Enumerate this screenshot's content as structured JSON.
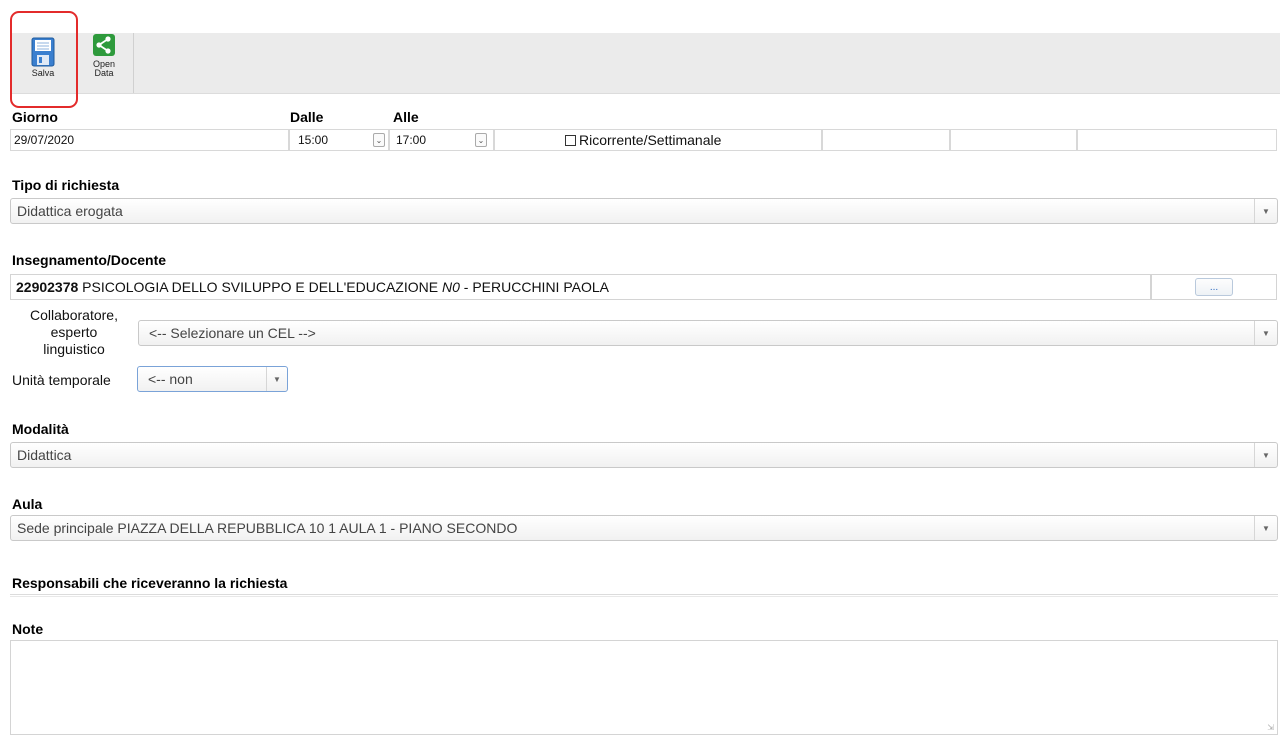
{
  "toolbar": {
    "save_label": "Salva",
    "opendata_label_1": "Open",
    "opendata_label_2": "Data"
  },
  "date_row": {
    "giorno_label": "Giorno",
    "dalle_label": "Dalle",
    "alle_label": "Alle",
    "giorno_value": "29/07/2020",
    "dalle_value": "15:00",
    "alle_value": "17:00",
    "ricorrente_label": "Ricorrente/Settimanale",
    "ricorrente_checked": false
  },
  "tipo": {
    "label": "Tipo di richiesta",
    "value": "Didattica erogata"
  },
  "insegnamento": {
    "label": "Insegnamento/Docente",
    "code": "22902378",
    "course": " PSICOLOGIA DELLO SVILUPPO E DELL'EDUCAZIONE ",
    "channel": "N0",
    "teacher": " - PERUCCHINI PAOLA",
    "more_button": "..."
  },
  "cel": {
    "label_1": "Collaboratore,",
    "label_2": "esperto",
    "label_3": "linguistico",
    "value": "<-- Selezionare un CEL -->"
  },
  "unita": {
    "label": "Unità temporale",
    "value": "<-- non"
  },
  "modalita": {
    "label": "Modalità",
    "value": "Didattica"
  },
  "aula": {
    "label": "Aula",
    "value": "Sede principale PIAZZA DELLA REPUBBLICA 10 1 AULA 1 - PIANO SECONDO"
  },
  "responsabili": {
    "label": "Responsabili che riceveranno la richiesta"
  },
  "note": {
    "label": "Note",
    "value": ""
  },
  "colors": {
    "highlight": "#e32b2b",
    "save_icon": "#3a7fcf",
    "share_icon": "#2e9a3c"
  }
}
